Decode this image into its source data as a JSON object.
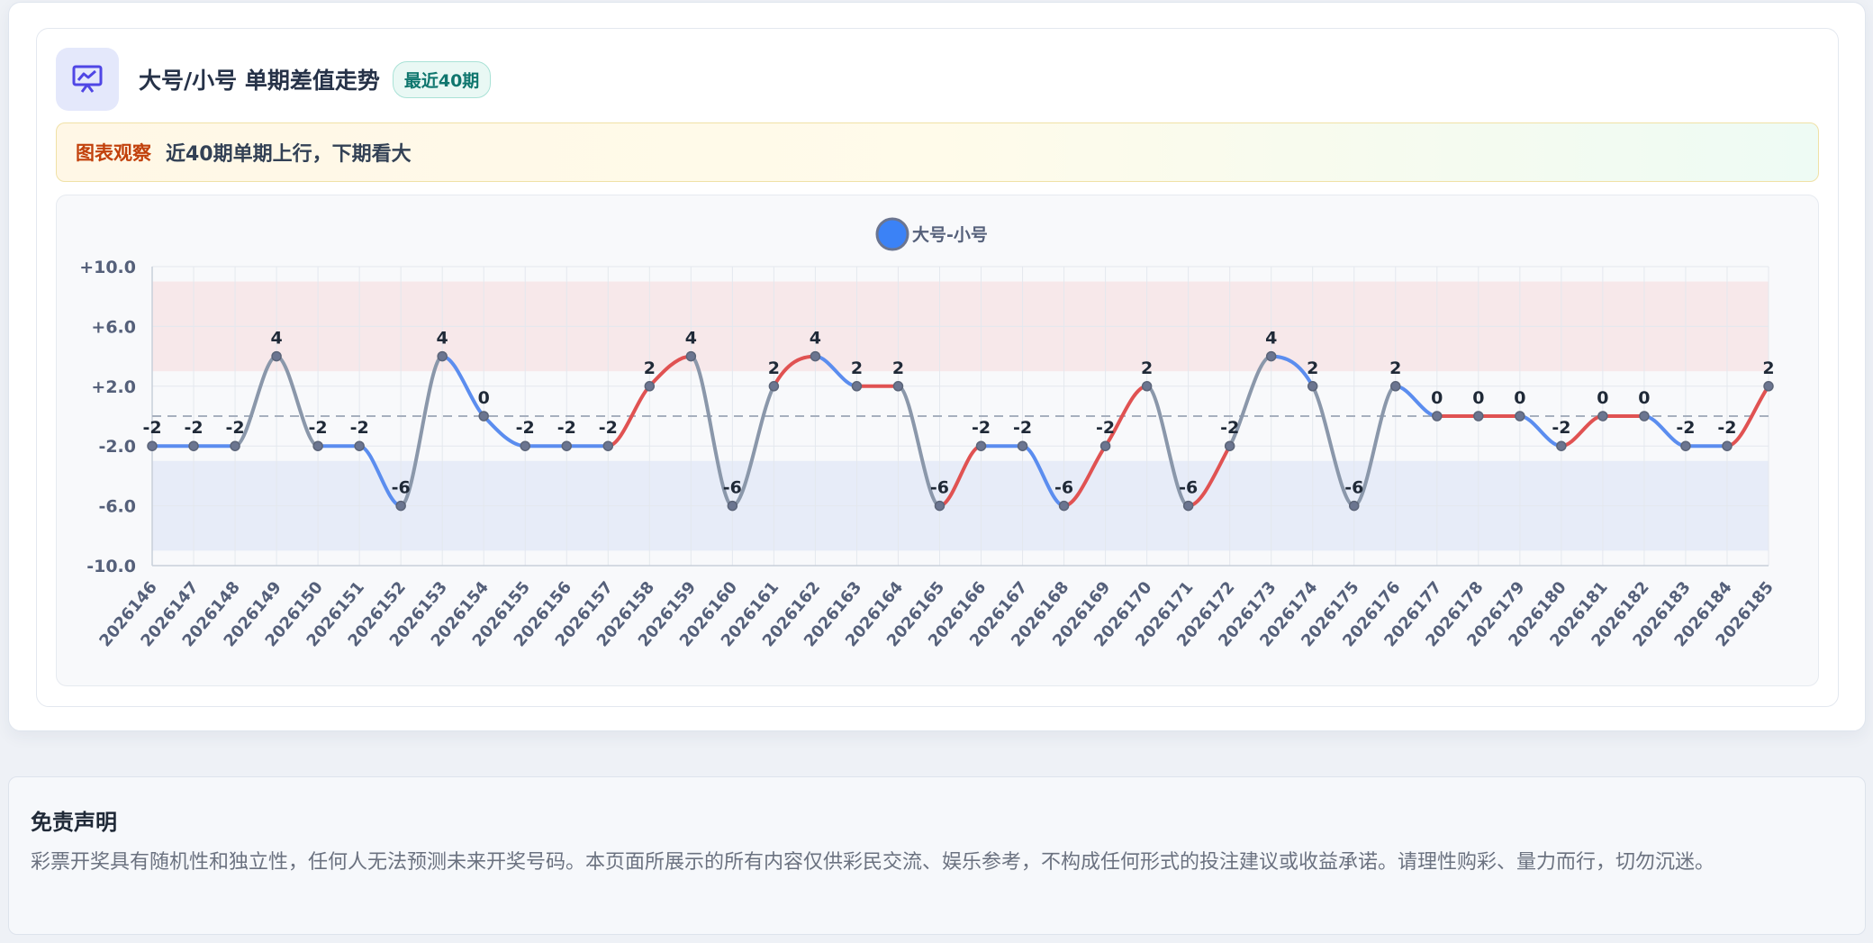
{
  "header": {
    "title": "大号/小号 单期差值走势",
    "badge": "最近40期"
  },
  "observation": {
    "label": "图表观察",
    "text": "近40期单期上行，下期看大"
  },
  "colors": {
    "up": "#e05252",
    "down": "#5b8def",
    "flat": "#8a97aa",
    "legend": "#3b82f6",
    "upper_band": "#f7e8ea",
    "lower_band": "#e7ecf8"
  },
  "chart_data": {
    "type": "line",
    "legend": [
      "大号-小号"
    ],
    "legend_position": "top-center",
    "x": [
      "2026146",
      "2026147",
      "2026148",
      "2026149",
      "2026150",
      "2026151",
      "2026152",
      "2026153",
      "2026154",
      "2026155",
      "2026156",
      "2026157",
      "2026158",
      "2026159",
      "2026160",
      "2026161",
      "2026162",
      "2026163",
      "2026164",
      "2026165",
      "2026166",
      "2026167",
      "2026168",
      "2026169",
      "2026170",
      "2026171",
      "2026172",
      "2026173",
      "2026174",
      "2026175",
      "2026176",
      "2026177",
      "2026178",
      "2026179",
      "2026180",
      "2026181",
      "2026182",
      "2026183",
      "2026184",
      "2026185"
    ],
    "series": [
      {
        "name": "大号-小号",
        "values": [
          -2,
          -2,
          -2,
          4,
          -2,
          -2,
          -6,
          4,
          0,
          -2,
          -2,
          -2,
          2,
          4,
          -6,
          2,
          4,
          2,
          2,
          -6,
          -2,
          -2,
          -6,
          -2,
          2,
          -6,
          -2,
          4,
          2,
          -6,
          2,
          0,
          0,
          0,
          -2,
          0,
          0,
          -2,
          -2,
          2
        ]
      }
    ],
    "ylim": [
      -10,
      10
    ],
    "yticks": [
      "+10.0",
      "+6.0",
      "+2.0",
      "-2.0",
      "-6.0",
      "-10.0"
    ],
    "ytick_values": [
      10,
      6,
      2,
      -2,
      -6,
      -10
    ],
    "bands": [
      {
        "from": 3,
        "to": 9
      },
      {
        "from": -9,
        "to": -3
      }
    ],
    "reference_line": 0,
    "grid": true,
    "data_labels": true
  },
  "disclaimer": {
    "title": "免责声明",
    "text": "彩票开奖具有随机性和独立性，任何人无法预测未来开奖号码。本页面所展示的所有内容仅供彩民交流、娱乐参考，不构成任何形式的投注建议或收益承诺。请理性购彩、量力而行，切勿沉迷。"
  }
}
